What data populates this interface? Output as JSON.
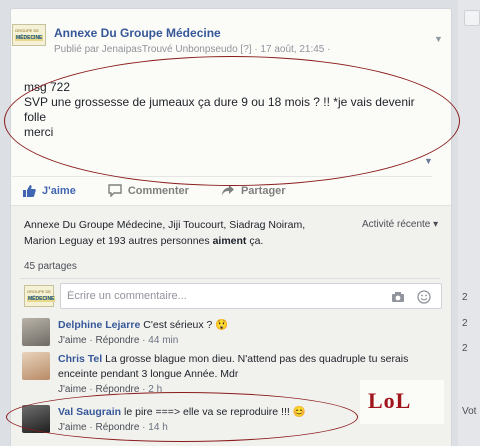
{
  "post": {
    "page_name": "Annexe Du Groupe Médecine",
    "published_by": "Publié par JenaipasTrouvé Unbonpseudo [?] · 17 août, 21:45 ·",
    "logo_lines": [
      "GROUPE DE",
      "MÉDECINE"
    ],
    "text_lines": [
      "msg 722",
      "SVP une grossesse de jumeaux ça dure 9 ou 18 mois ? !! *je vais devenir",
      "folle",
      "merci"
    ]
  },
  "actions": {
    "like": "J'aime",
    "comment": "Commenter",
    "share": "Partager"
  },
  "likes": {
    "names": "Annexe Du Groupe Médecine, Jiji Toucourt, Siadrag Noiram,",
    "line2_names": "Marion Leguay",
    "others": " et 193 autres personnes ",
    "suffix_bold": "aiment",
    "suffix": " ça."
  },
  "activity_filter": "Activité récente ▾",
  "shares": "45 partages",
  "comment_box": {
    "placeholder": "Écrire un commentaire..."
  },
  "comments": [
    {
      "name": "Delphine Lejarre",
      "text": "C'est sérieux ? 😲",
      "like": "J'aime",
      "reply": "Répondre",
      "time": "44 min"
    },
    {
      "name": "Chris Tel",
      "text": "La grosse blague mon dieu. N'attend pas des quadruple tu serais enceinte pendant 3 longue Année. Mdr",
      "like": "J'aime",
      "reply": "Répondre",
      "time": "2 h"
    },
    {
      "name": "Val Saugrain",
      "text": "le pire ===> elle va se reproduire !!! 😊",
      "like": "J'aime",
      "reply": "Répondre",
      "time": "14 h"
    }
  ],
  "overlay_text": "LoL",
  "right_column": {
    "digits": [
      "2",
      "2",
      "2"
    ],
    "label": "Vot"
  },
  "colors": {
    "link": "#365899",
    "like_active": "#4267b2",
    "annotation": "#8a1c1c",
    "lol": "#a0141b"
  }
}
